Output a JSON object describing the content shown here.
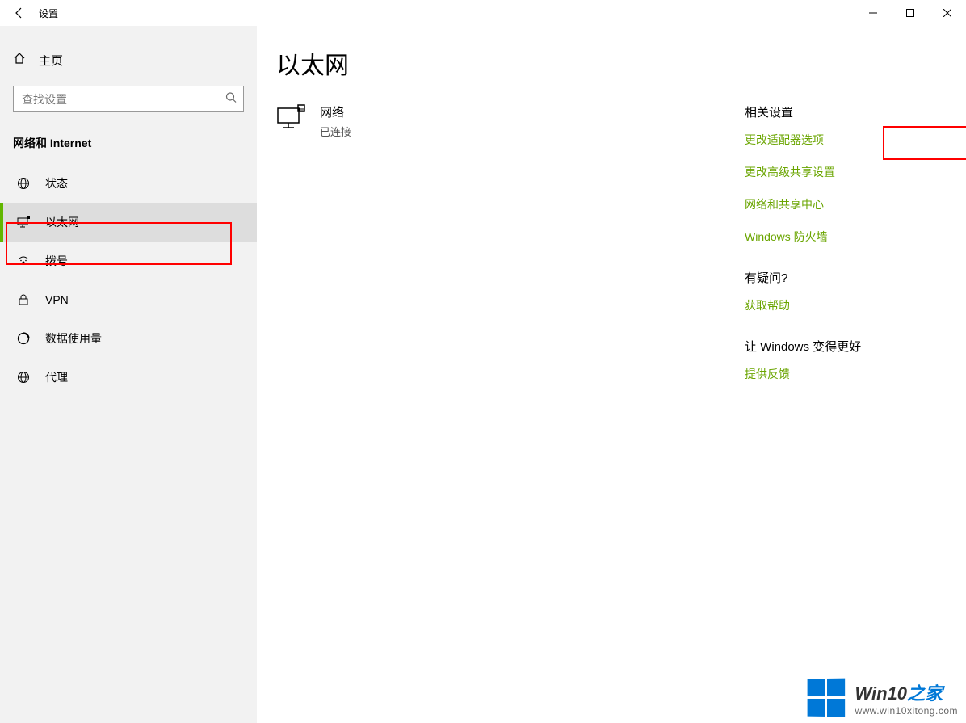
{
  "titlebar": {
    "title": "设置"
  },
  "sidebar": {
    "home": "主页",
    "search_placeholder": "查找设置",
    "section": "网络和 Internet",
    "items": [
      {
        "label": "状态"
      },
      {
        "label": "以太网"
      },
      {
        "label": "拨号"
      },
      {
        "label": "VPN"
      },
      {
        "label": "数据使用量"
      },
      {
        "label": "代理"
      }
    ]
  },
  "main": {
    "title": "以太网",
    "network": {
      "name": "网络",
      "status": "已连接"
    }
  },
  "related": {
    "heading": "相关设置",
    "links": [
      "更改适配器选项",
      "更改高级共享设置",
      "网络和共享中心",
      "Windows 防火墙"
    ]
  },
  "help": {
    "heading": "有疑问?",
    "link": "获取帮助"
  },
  "feedback": {
    "heading": "让 Windows 变得更好",
    "link": "提供反馈"
  },
  "watermark": {
    "brand_prefix": "Win10",
    "brand_suffix": "之家",
    "url": "www.win10xitong.com"
  }
}
